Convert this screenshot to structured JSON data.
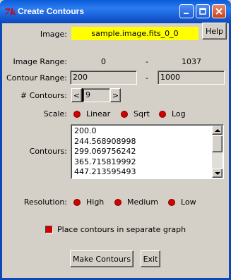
{
  "window": {
    "title": "Create Contours",
    "app_icon": "tk-feather-icon",
    "logo_text": "7k"
  },
  "help_label": "Help",
  "image": {
    "label": "Image:",
    "value": "sample.image.fits_0_0",
    "highlight_color": "#ffff00"
  },
  "image_range": {
    "label": "Image Range:",
    "min": "0",
    "separator": "-",
    "max": "1037"
  },
  "contour_range": {
    "label": "Contour Range:",
    "min": "200",
    "separator": "-",
    "max": "1000"
  },
  "num_contours": {
    "label": "# Contours:",
    "value": "9",
    "dec_label": "<",
    "inc_label": ">"
  },
  "scale": {
    "label": "Scale:",
    "options": [
      "Linear",
      "Sqrt",
      "Log"
    ]
  },
  "contours": {
    "label": "Contours:",
    "values": [
      "200.0",
      "244.568908998",
      "299.069756242",
      "365.715819992",
      "447.213595493"
    ]
  },
  "resolution": {
    "label": "Resolution:",
    "options": [
      "High",
      "Medium",
      "Low"
    ]
  },
  "separate_graph": {
    "label": "Place contours in separate graph",
    "checked": true
  },
  "buttons": {
    "make_contours": "Make Contours",
    "exit": "Exit"
  },
  "colors": {
    "accent": "#d40000",
    "titlebar": "#0b47b8",
    "background": "#d4d0c8"
  }
}
